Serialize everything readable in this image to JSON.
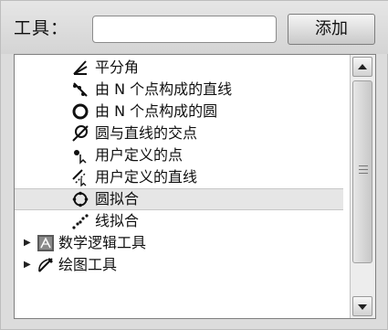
{
  "toolbar": {
    "label": "工具：",
    "input_value": "",
    "add_button_label": "添加"
  },
  "tree": {
    "items": [
      {
        "label": "平分角",
        "icon": "angle-bisector-icon",
        "indent": "child"
      },
      {
        "label": "由 N 个点构成的直线",
        "icon": "points-line-fit-icon",
        "indent": "child"
      },
      {
        "label": "由 N 个点构成的圆",
        "icon": "points-circle-icon",
        "indent": "child"
      },
      {
        "label": "圆与直线的交点",
        "icon": "circle-line-intersection-icon",
        "indent": "child"
      },
      {
        "label": "用户定义的点",
        "icon": "custom-point-icon",
        "indent": "child"
      },
      {
        "label": "用户定义的直线",
        "icon": "custom-line-icon",
        "indent": "child"
      },
      {
        "label": "圆拟合",
        "icon": "circle-fit-icon",
        "indent": "child",
        "selected": true
      },
      {
        "label": "线拟合",
        "icon": "line-fit-icon",
        "indent": "child"
      },
      {
        "label": "数学逻辑工具",
        "icon": "math-logic-icon",
        "indent": "group"
      },
      {
        "label": "绘图工具",
        "icon": "drawing-tools-icon",
        "indent": "group"
      }
    ]
  },
  "colors": {
    "panel_bg": "#dcdcdc",
    "selected_row_bg": "#e6e6e6"
  }
}
